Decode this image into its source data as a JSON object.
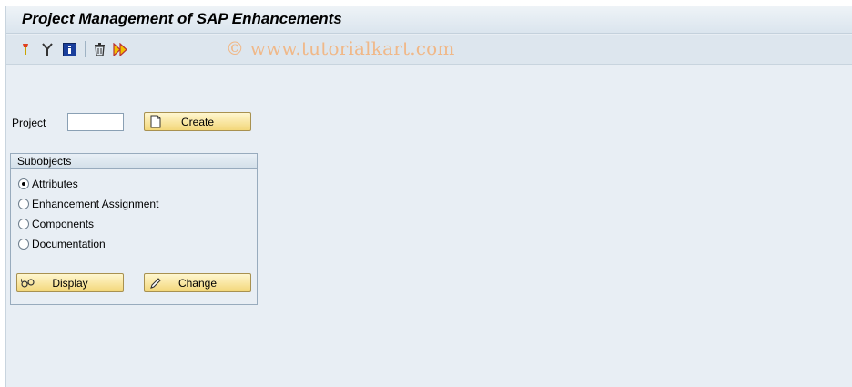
{
  "window": {
    "title": "Project Management of SAP Enhancements"
  },
  "toolbar": {
    "icons": [
      "other-object-icon",
      "where-used-icon",
      "info-icon",
      "delete-icon",
      "activate-icon"
    ],
    "watermark": "© www.tutorialkart.com"
  },
  "form": {
    "project_label": "Project",
    "project_value": "",
    "create_label": "Create"
  },
  "subobjects": {
    "title": "Subobjects",
    "options": [
      {
        "label": "Attributes",
        "checked": true
      },
      {
        "label": "Enhancement Assignment",
        "checked": false
      },
      {
        "label": "Components",
        "checked": false
      },
      {
        "label": "Documentation",
        "checked": false
      }
    ],
    "display_label": "Display",
    "change_label": "Change"
  }
}
